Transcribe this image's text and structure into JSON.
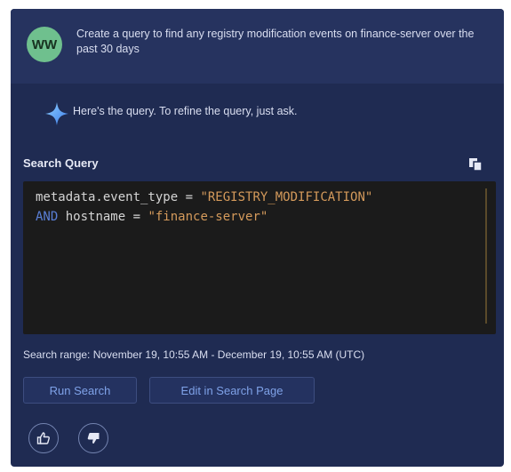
{
  "user": {
    "initials": "WW",
    "message": "Create a query to find any registry modification events on finance-server over the past 30 days"
  },
  "assistant": {
    "message": "Here's the query. To refine the query, just ask."
  },
  "query": {
    "label": "Search Query",
    "line1_field": "metadata.event_type",
    "line1_op": " = ",
    "line1_value": "\"REGISTRY_MODIFICATION\"",
    "line2_keyword": "AND",
    "line2_field": " hostname",
    "line2_op": " = ",
    "line2_value": "\"finance-server\""
  },
  "search_range": "Search range: November 19, 10:55 AM - December 19, 10:55 AM (UTC)",
  "buttons": {
    "run": "Run Search",
    "edit": "Edit in Search Page"
  },
  "icons": {
    "copy": "copy-icon",
    "sparkle": "sparkle-icon",
    "thumbs_up": "thumbs-up-icon",
    "thumbs_down": "thumbs-down-icon"
  },
  "colors": {
    "panel_bg": "#1f2b52",
    "avatar": "#6fc08e",
    "string": "#d49a5b",
    "keyword": "#5a7fd6",
    "button_text": "#7fa2e8"
  }
}
